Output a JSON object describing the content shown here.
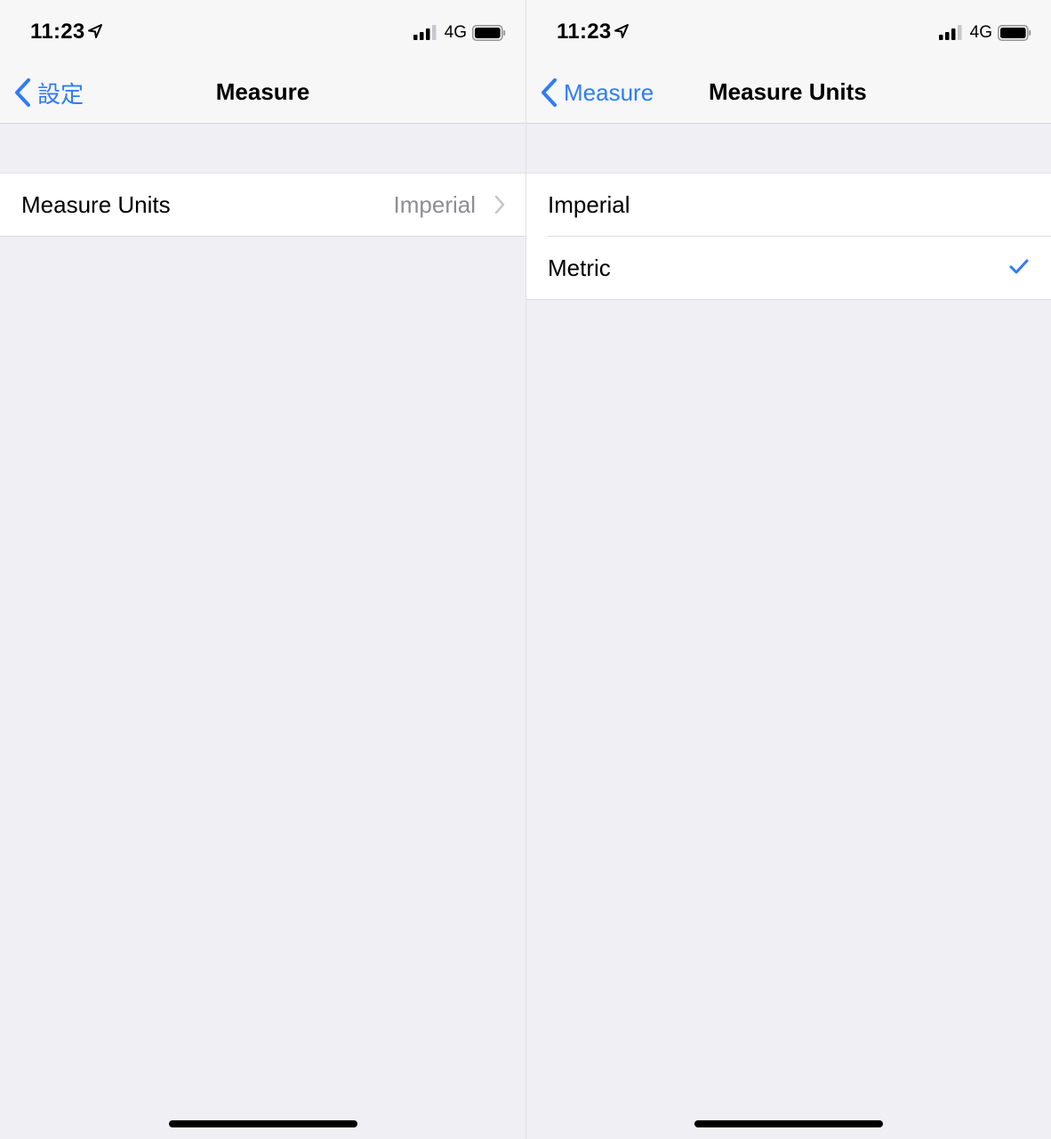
{
  "screens": [
    {
      "status": {
        "time": "11:23",
        "network": "4G",
        "signal_bars": 3,
        "signal_max": 4,
        "battery_level": 0.95
      },
      "nav": {
        "back_label": "設定",
        "title": "Measure"
      },
      "cells": [
        {
          "label": "Measure Units",
          "value": "Imperial",
          "accessory": "chevron-right"
        }
      ]
    },
    {
      "status": {
        "time": "11:23",
        "network": "4G",
        "signal_bars": 3,
        "signal_max": 4,
        "battery_level": 0.95
      },
      "nav": {
        "back_label": "Measure",
        "title": "Measure Units"
      },
      "options": [
        {
          "label": "Imperial",
          "selected": false
        },
        {
          "label": "Metric",
          "selected": true
        }
      ]
    }
  ],
  "colors": {
    "accent": "#2f7cf6",
    "secondary_text": "#8e8e93",
    "background": "#efeff4"
  }
}
